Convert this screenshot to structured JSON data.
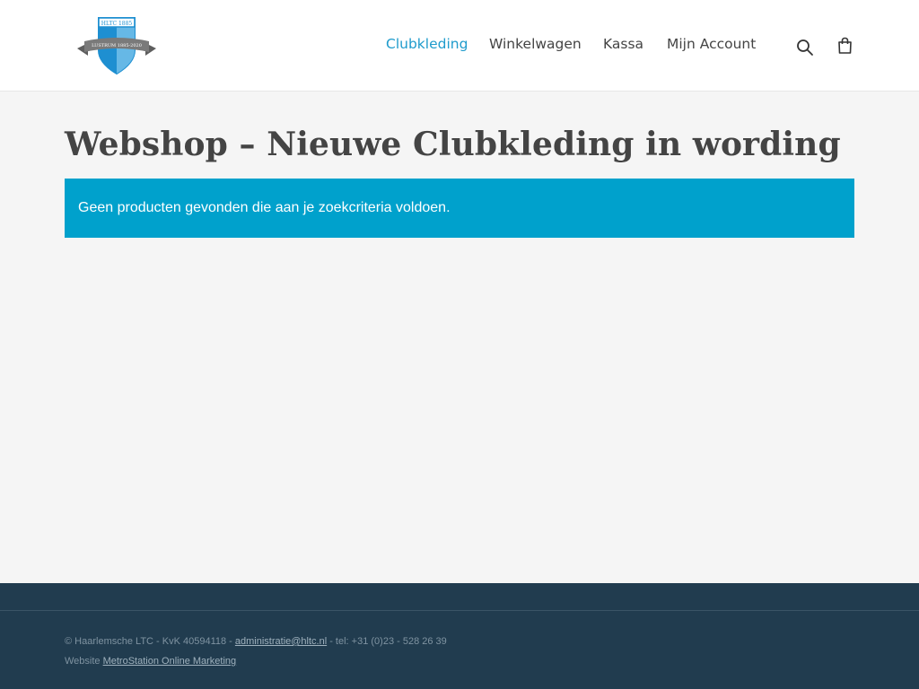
{
  "header": {
    "logo": {
      "icon": "club-shield-logo",
      "top_text": "HLTC 1885",
      "ribbon_text": "LUSTRUM 1885-2020",
      "colors": {
        "blue": "#1e8fd1",
        "ribbon": "#7a7a7a"
      }
    },
    "nav": {
      "items": [
        {
          "label": "Clubkleding",
          "active": true
        },
        {
          "label": "Winkelwagen",
          "active": false
        },
        {
          "label": "Kassa",
          "active": false
        },
        {
          "label": "Mijn Account",
          "active": false
        }
      ],
      "search_icon": "search-icon",
      "cart_icon": "shopping-bag-icon"
    }
  },
  "main": {
    "title": "Webshop – Nieuwe Clubkleding in wording",
    "notice": "Geen producten gevonden die aan je zoekcriteria voldoen."
  },
  "footer": {
    "line1_prefix": "© Haarlemsche LTC - KvK 40594118 - ",
    "email": "administratie@hltc.nl",
    "line1_suffix": " - tel: +31 (0)23 - 528 26 39",
    "line2_prefix": "Website ",
    "agency": "MetroStation Online Marketing"
  },
  "colors": {
    "accent": "#1e9bcc",
    "notice_bg": "#00a1cc",
    "footer_bg": "#213c4f",
    "page_bg": "#f5f5f5"
  }
}
